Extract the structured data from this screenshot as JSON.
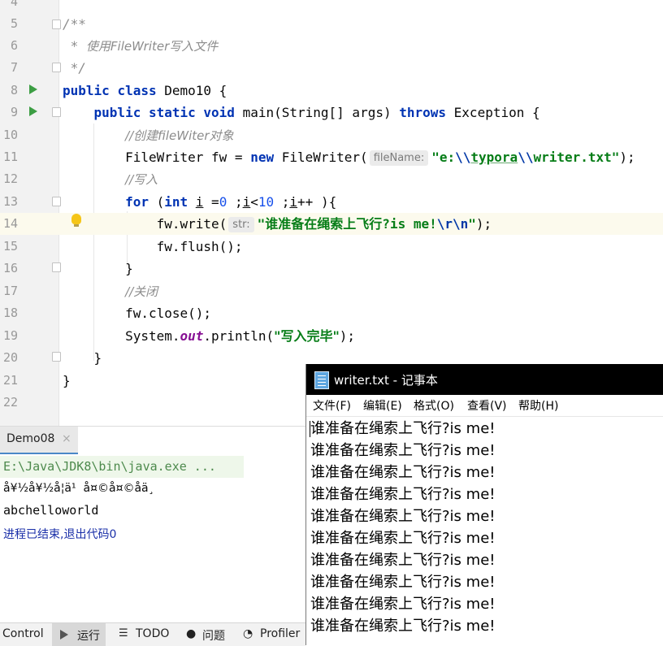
{
  "editor": {
    "line_numbers": [
      "4",
      "5",
      "6",
      "7",
      "8",
      "9",
      "10",
      "11",
      "12",
      "13",
      "14",
      "15",
      "16",
      "17",
      "18",
      "19",
      "20",
      "21",
      "22"
    ],
    "comment_open": "/**",
    "comment_star": "* ",
    "comment_text": "使用FileWriter写入文件",
    "comment_close": "*/",
    "l8_public": "public",
    "l8_class": "class",
    "l8_rest": " Demo10 {",
    "l9_public": "public",
    "l9_static": "static",
    "l9_void": "void",
    "l9_rest1": " main(String[] args) ",
    "l9_throws": "throws",
    "l9_rest2": " Exception {",
    "l10_comment": "//创建fileWiter对象",
    "l11_a": "FileWriter fw = ",
    "l11_new": "new",
    "l11_b": " FileWriter(",
    "l11_hint": "fileName:",
    "l11_q1": "\"e:",
    "l11_e1": "\\\\",
    "l11_s2": "typora",
    "l11_e2": "\\\\",
    "l11_s3": "writer.txt\"",
    "l11_end": ");",
    "l12_comment": "//写入",
    "l13_for": "for",
    "l13_a": " (",
    "l13_int": "int",
    "l13_b": " ",
    "l13_i1": "i",
    "l13_c": " =",
    "l13_zero": "0",
    "l13_d": " ;",
    "l13_i2": "i",
    "l13_e": "<",
    "l13_ten": "10",
    "l13_f": " ;",
    "l13_i3": "i",
    "l13_g": "++ ){",
    "l14_a": "fw.write(",
    "l14_hint": "str:",
    "l14_str": "\"谁准备在绳索上飞行?is me!",
    "l14_esc": "\\r\\n",
    "l14_q": "\"",
    "l14_end": ");",
    "l15": "fw.flush();",
    "l16": "}",
    "l17_comment": "//关闭",
    "l18": "fw.close();",
    "l19_a": "System.",
    "l19_out": "out",
    "l19_b": ".println(",
    "l19_str": "\"写入完毕\"",
    "l19_end": ");",
    "l20": "}",
    "l21": "}"
  },
  "run_panel": {
    "tab_label": "Demo08",
    "tab_close": "×",
    "cmd": "E:\\Java\\JDK8\\bin\\java.exe ...",
    "garbled": "å¥½å¥½å­¦ä¹  å¤©å¤©åä¸",
    "output": "abchelloworld",
    "finished": "进程已结束,退出代码0"
  },
  "bottom_bar": {
    "control": "Control",
    "run": "运行",
    "todo": "TODO",
    "problems": "问题",
    "profiler": "Profiler"
  },
  "notepad": {
    "title": "writer.txt - 记事本",
    "menu": [
      "文件(F)",
      "编辑(E)",
      "格式(O)",
      "查看(V)",
      "帮助(H)"
    ],
    "lines": [
      "谁准备在绳索上飞行?is me!",
      "谁准备在绳索上飞行?is me!",
      "谁准备在绳索上飞行?is me!",
      "谁准备在绳索上飞行?is me!",
      "谁准备在绳索上飞行?is me!",
      "谁准备在绳索上飞行?is me!",
      "谁准备在绳索上飞行?is me!",
      "谁准备在绳索上飞行?is me!",
      "谁准备在绳索上飞行?is me!",
      "谁准备在绳索上飞行?is me!"
    ]
  }
}
